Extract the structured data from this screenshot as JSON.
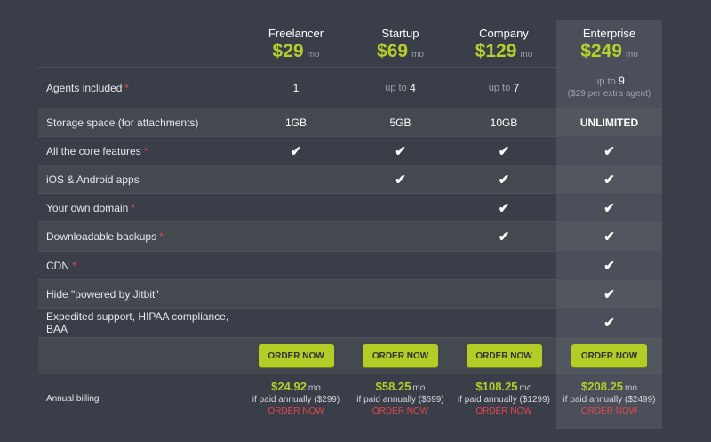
{
  "plans": [
    {
      "name": "Freelancer",
      "price": "$29",
      "unit": "mo"
    },
    {
      "name": "Startup",
      "price": "$69",
      "unit": "mo"
    },
    {
      "name": "Company",
      "price": "$129",
      "unit": "mo"
    },
    {
      "name": "Enterprise",
      "price": "$249",
      "unit": "mo"
    }
  ],
  "rows": {
    "agents": {
      "label": "Agents included",
      "star": "*",
      "freelancer": "1",
      "startup_prefix": "up to",
      "startup_value": "4",
      "company_prefix": "up to",
      "company_value": "7",
      "enterprise_prefix": "up to",
      "enterprise_value": "9",
      "enterprise_note": "($29 per extra agent)"
    },
    "storage": {
      "label": "Storage space (for attachments)",
      "freelancer": "1GB",
      "startup": "5GB",
      "company": "10GB",
      "enterprise": "UNLIMITED"
    },
    "core": {
      "label": "All the core features",
      "star": "*"
    },
    "apps": {
      "label": "iOS & Android apps"
    },
    "domain": {
      "label": "Your own domain",
      "star": "*"
    },
    "backups": {
      "label": "Downloadable backups",
      "star": "*"
    },
    "cdn": {
      "label": "CDN",
      "star": "*"
    },
    "hide": {
      "label": "Hide \"powered by Jitbit\""
    },
    "support": {
      "label": "Expedited support, HIPAA compliance, BAA"
    }
  },
  "check_glyph": "✔",
  "order_button": "ORDER NOW",
  "annual": {
    "label": "Annual billing",
    "unit": "mo",
    "order_link": "ORDER NOW",
    "plans": [
      {
        "price": "$24.92",
        "note": "if paid annually ($299)"
      },
      {
        "price": "$58.25",
        "note": "if paid annually ($699)"
      },
      {
        "price": "$108.25",
        "note": "if paid annually ($1299)"
      },
      {
        "price": "$208.25",
        "note": "if paid annually ($2499)"
      }
    ]
  }
}
